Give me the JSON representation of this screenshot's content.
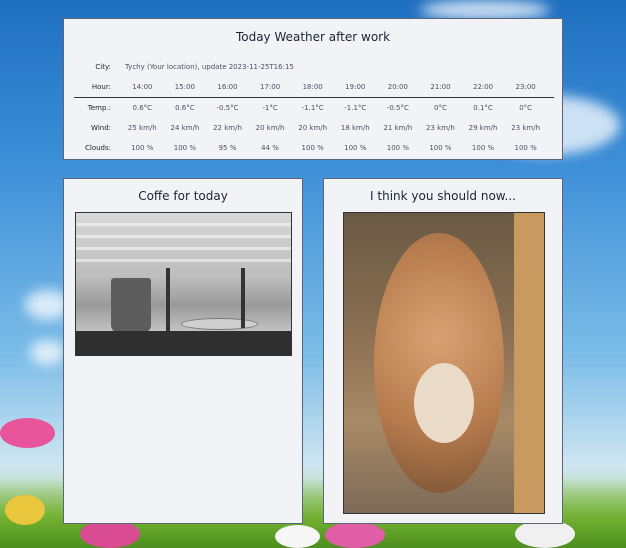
{
  "weather": {
    "title": "Today Weather after work",
    "city_label": "City:",
    "city_value": "Tychy (Your location), update 2023-11-25T16:15",
    "hour_label": "Hour:",
    "temp_label": "Temp.:",
    "wind_label": "Wind:",
    "clouds_label": "Clouds:",
    "hours": [
      "14:00",
      "15:00",
      "16:00",
      "17:00",
      "18:00",
      "19:00",
      "20:00",
      "21:00",
      "22:00",
      "23:00"
    ],
    "temps": [
      "0.6°C",
      "0.6°C",
      "-0.5°C",
      "-1°C",
      "-1.1°C",
      "-1.1°C",
      "-0.5°C",
      "0°C",
      "0.1°C",
      "0°C"
    ],
    "winds": [
      "25 km/h",
      "24 km/h",
      "22 km/h",
      "20 km/h",
      "20 km/h",
      "18 km/h",
      "21 km/h",
      "23 km/h",
      "29 km/h",
      "23 km/h"
    ],
    "clouds": [
      "100 %",
      "100 %",
      "95 %",
      "44 %",
      "100 %",
      "100 %",
      "100 %",
      "100 %",
      "100 %",
      "100 %"
    ]
  },
  "coffee": {
    "title": "Coffe for today"
  },
  "cat": {
    "title": "I think you should now..."
  }
}
